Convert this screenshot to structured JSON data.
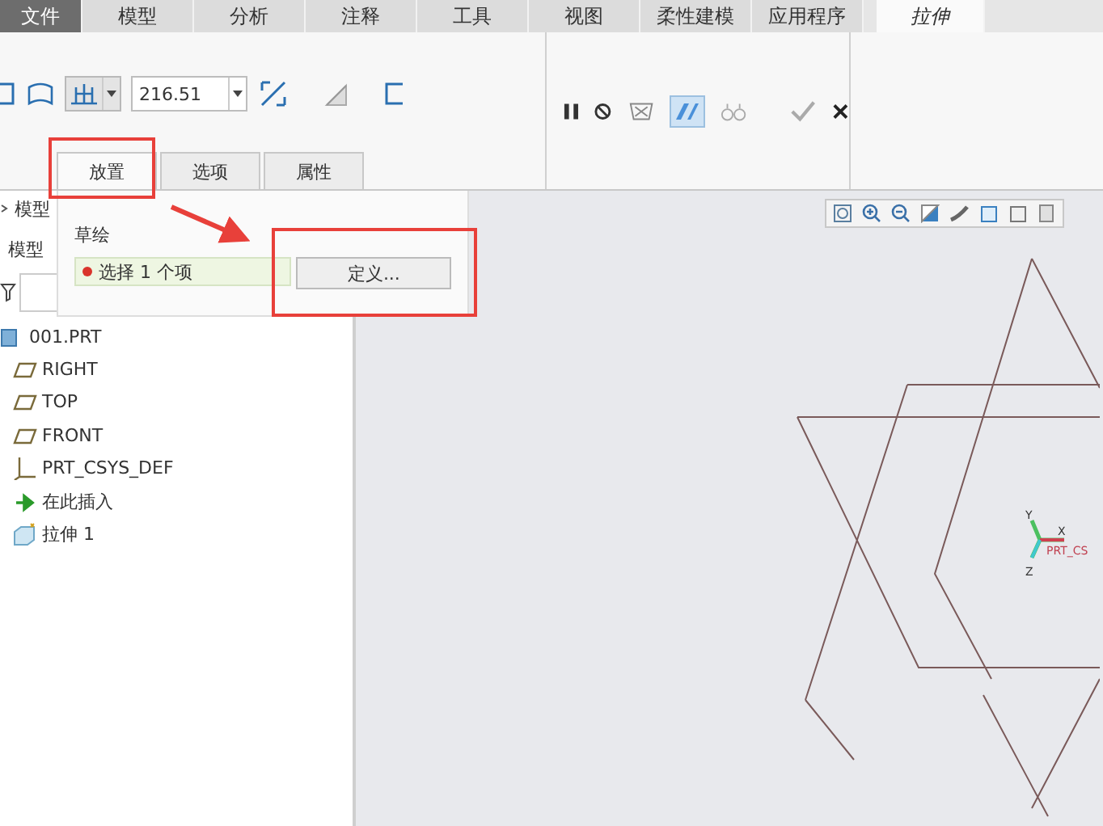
{
  "menu_tabs": [
    {
      "label": "文件",
      "kind": "file",
      "selected": false
    },
    {
      "label": "模型",
      "kind": "tab",
      "selected": false
    },
    {
      "label": "分析",
      "kind": "tab",
      "selected": false
    },
    {
      "label": "注释",
      "kind": "tab",
      "selected": false
    },
    {
      "label": "工具",
      "kind": "tab",
      "selected": false
    },
    {
      "label": "视图",
      "kind": "tab",
      "selected": false
    },
    {
      "label": "柔性建模",
      "kind": "tab",
      "selected": false
    },
    {
      "label": "应用程序",
      "kind": "tab",
      "selected": false
    },
    {
      "label": "拉伸",
      "kind": "tab",
      "selected": true
    }
  ],
  "ribbon": {
    "depth_value": "216.51",
    "panel_tabs": [
      {
        "label": "放置",
        "selected": true
      },
      {
        "label": "选项",
        "selected": false
      },
      {
        "label": "属性",
        "selected": false
      }
    ]
  },
  "placement_panel": {
    "section_label": "草绘",
    "collector": {
      "text": "选择 1 个项",
      "color": "#d9342b"
    },
    "define_button": "定义..."
  },
  "model_tree": {
    "header": "模型",
    "filter_label": "模型",
    "items": [
      {
        "label": "001.PRT",
        "kind": "part"
      },
      {
        "label": "RIGHT",
        "kind": "plane"
      },
      {
        "label": "TOP",
        "kind": "plane"
      },
      {
        "label": "FRONT",
        "kind": "plane"
      },
      {
        "label": "PRT_CSYS_DEF",
        "kind": "csys"
      },
      {
        "label": "在此插入",
        "kind": "insert"
      },
      {
        "label": "拉伸 1",
        "kind": "feature"
      }
    ]
  },
  "viewport": {
    "csys_axes": [
      "Y",
      "X",
      "Z"
    ],
    "csys_name": "PRT_CS"
  }
}
